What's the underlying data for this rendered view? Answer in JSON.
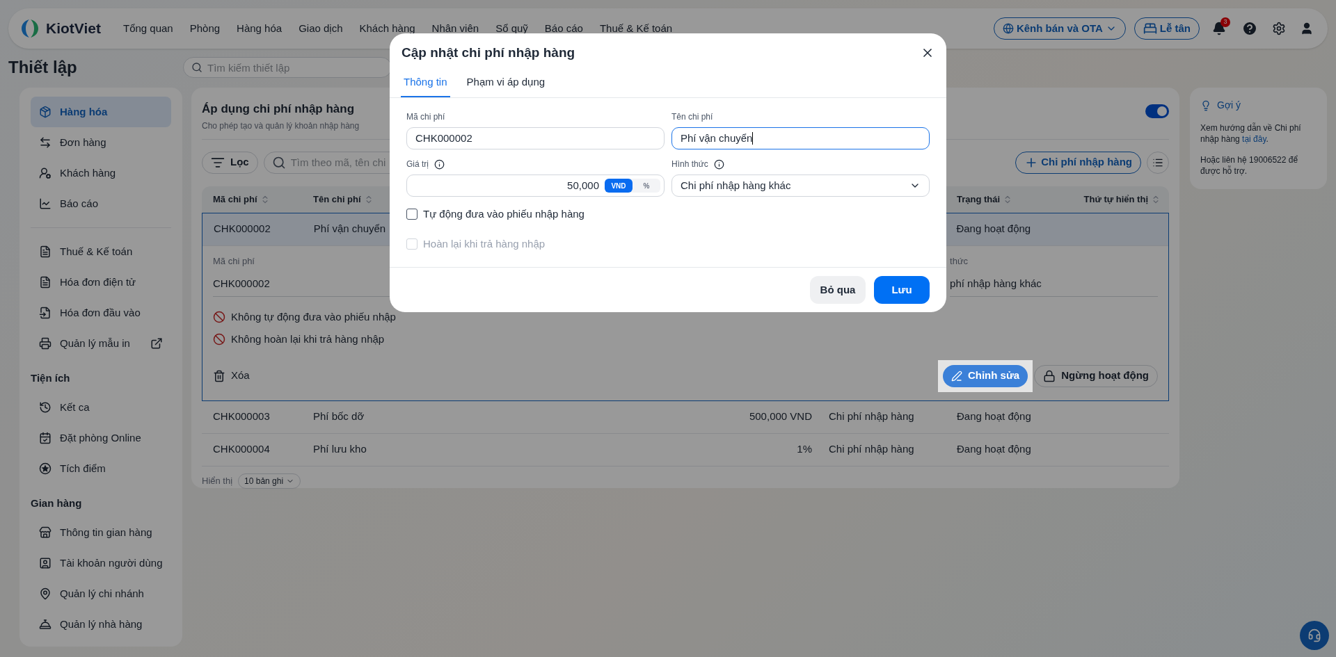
{
  "topbar": {
    "logo": "KiotViet",
    "menu": [
      "Tổng quan",
      "Phòng",
      "Hàng hóa",
      "Giao dịch",
      "Khách hàng",
      "Nhân viên",
      "Sổ quỹ",
      "Báo cáo",
      "Thuế & Kế toán"
    ],
    "channel_button": "Kênh bán và OTA",
    "reception_button": "Lễ tân",
    "notification_count": "3"
  },
  "page_title": "Thiết lập",
  "settings_search": {
    "placeholder": "Tìm kiếm thiết lập"
  },
  "sidebar": {
    "sections": [
      {
        "items": [
          {
            "label": "Hàng hóa",
            "selected": true,
            "external": false
          },
          {
            "label": "Đơn hàng",
            "selected": false,
            "external": false
          },
          {
            "label": "Khách hàng",
            "selected": false,
            "external": false
          },
          {
            "label": "Báo cáo",
            "selected": false,
            "external": false
          }
        ]
      },
      {
        "items": [
          {
            "label": "Thuế & Kế toán",
            "selected": false,
            "external": false
          },
          {
            "label": "Hóa đơn điện tử",
            "selected": false,
            "external": false
          },
          {
            "label": "Hóa đơn đầu vào",
            "selected": false,
            "external": false
          },
          {
            "label": "Quản lý mẫu in",
            "selected": false,
            "external": true
          }
        ]
      },
      {
        "heading": "Tiện ích",
        "items": [
          {
            "label": "Kết ca",
            "selected": false,
            "external": false
          },
          {
            "label": "Đặt phòng Online",
            "selected": false,
            "external": false
          },
          {
            "label": "Tích điểm",
            "selected": false,
            "external": false
          }
        ]
      },
      {
        "heading": "Gian hàng",
        "items": [
          {
            "label": "Thông tin gian hàng",
            "selected": false,
            "external": false
          },
          {
            "label": "Tài khoản người dùng",
            "selected": false,
            "external": false
          },
          {
            "label": "Quản lý chi nhánh",
            "selected": false,
            "external": false
          },
          {
            "label": "Quản lý nhà hàng",
            "selected": false,
            "external": false
          }
        ]
      }
    ]
  },
  "card": {
    "title": "Áp dụng chi phí nhập hàng",
    "subtitle": "Cho phép tạo và quản lý khoản nhập hàng",
    "enabled": true,
    "filter_button": "Lọc",
    "search": {
      "placeholder": "Tìm theo mã, tên chi"
    },
    "add_button": "Chi phí nhập hàng",
    "table": {
      "columns": [
        {
          "label": "Mã chi phí"
        },
        {
          "label": "Tên chi phí"
        },
        {
          "label": "Trạng thái"
        },
        {
          "label": "Thứ tự hiển thị"
        }
      ],
      "rows": [
        {
          "code": "CHK000002",
          "name": "Phí vận chuyển",
          "status": "Đang hoạt động",
          "expanded": true,
          "detail": {
            "left_label": "Mã chi phí",
            "left_value": "CHK000002",
            "right_label": "thức",
            "right_value": "phí nhập hàng khác",
            "notes": [
              "Không tự động đưa vào phiếu nhập",
              "Không hoàn lại khi trả hàng nhập"
            ],
            "delete_button": "Xóa",
            "edit_button": "Chỉnh sửa",
            "deactivate_button": "Ngừng hoạt động"
          }
        },
        {
          "code": "CHK000003",
          "name": "Phí bốc dỡ",
          "value": "500,000 VND",
          "type": "Chi phí nhập hàng",
          "status": "Đang hoạt động",
          "expanded": false
        },
        {
          "code": "CHK000004",
          "name": "Phí lưu kho",
          "value": "1%",
          "type": "Chi phí nhập hàng",
          "status": "Đang hoạt động",
          "expanded": false
        }
      ]
    },
    "footer": {
      "label": "Hiển thị",
      "page_size": "10 bản ghi"
    }
  },
  "hint": {
    "title": "Gợi ý",
    "text_before": "Xem hướng dẫn về Chi phí nhập hàng ",
    "link": "tại đây",
    "text_after": ".",
    "contact": "Hoặc liên hệ 19006522 để được hỗ trợ."
  },
  "dialog": {
    "title": "Cập nhật chi phí nhập hàng",
    "tabs": [
      {
        "label": "Thông tin",
        "selected": true
      },
      {
        "label": "Phạm vi áp dụng",
        "selected": false
      }
    ],
    "code": {
      "label": "Mã chi phí",
      "value": "CHK000002",
      "focused": false
    },
    "name": {
      "label": "Tên chi phí",
      "value": "Phí vận chuyển",
      "focused": true
    },
    "amount": {
      "label": "Giá trị",
      "value": "50,000",
      "units": [
        {
          "label": "VND",
          "selected": true
        },
        {
          "label": "%",
          "selected": false
        }
      ]
    },
    "form": {
      "label": "Hình thức",
      "value": "Chi phí nhập hàng khác"
    },
    "checkboxes": [
      {
        "label": "Tự động đưa vào phiếu nhập hàng",
        "checked": false,
        "disabled": false
      },
      {
        "label": "Hoàn lại khi trả hàng nhập",
        "checked": false,
        "disabled": true
      }
    ],
    "cancel_button": "Bỏ qua",
    "save_button": "Lưu"
  }
}
